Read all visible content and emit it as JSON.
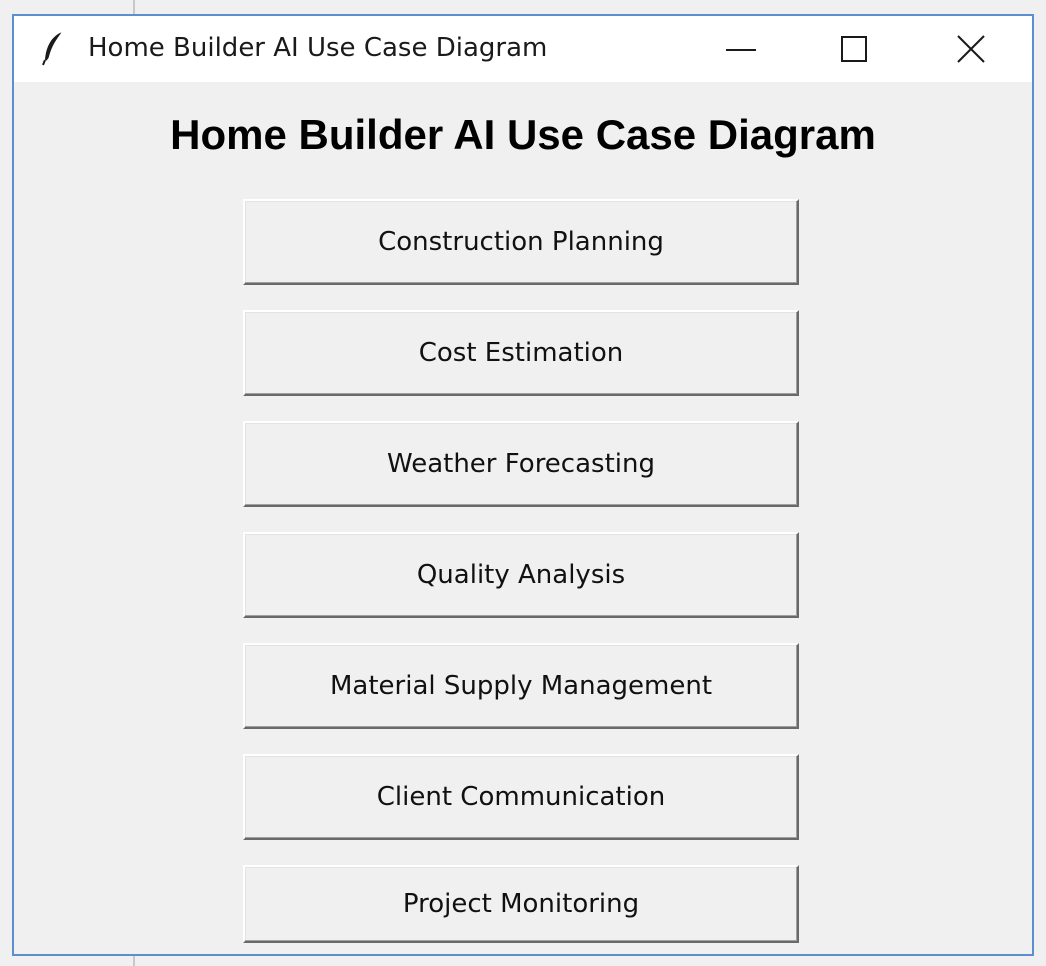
{
  "window": {
    "title": "Home Builder AI Use Case Diagram",
    "icon": "feather-icon",
    "controls": {
      "minimize_icon": "minimize-icon",
      "maximize_icon": "maximize-icon",
      "close_icon": "close-icon"
    }
  },
  "main": {
    "heading": "Home Builder AI Use Case Diagram",
    "use_cases": [
      {
        "label": "Construction Planning"
      },
      {
        "label": "Cost Estimation"
      },
      {
        "label": "Weather Forecasting"
      },
      {
        "label": "Quality Analysis"
      },
      {
        "label": "Material Supply Management"
      },
      {
        "label": "Client Communication"
      },
      {
        "label": "Project Monitoring"
      }
    ]
  },
  "colors": {
    "window_border": "#5b8fd0",
    "background": "#f0f0f0",
    "titlebar": "#ffffff"
  }
}
